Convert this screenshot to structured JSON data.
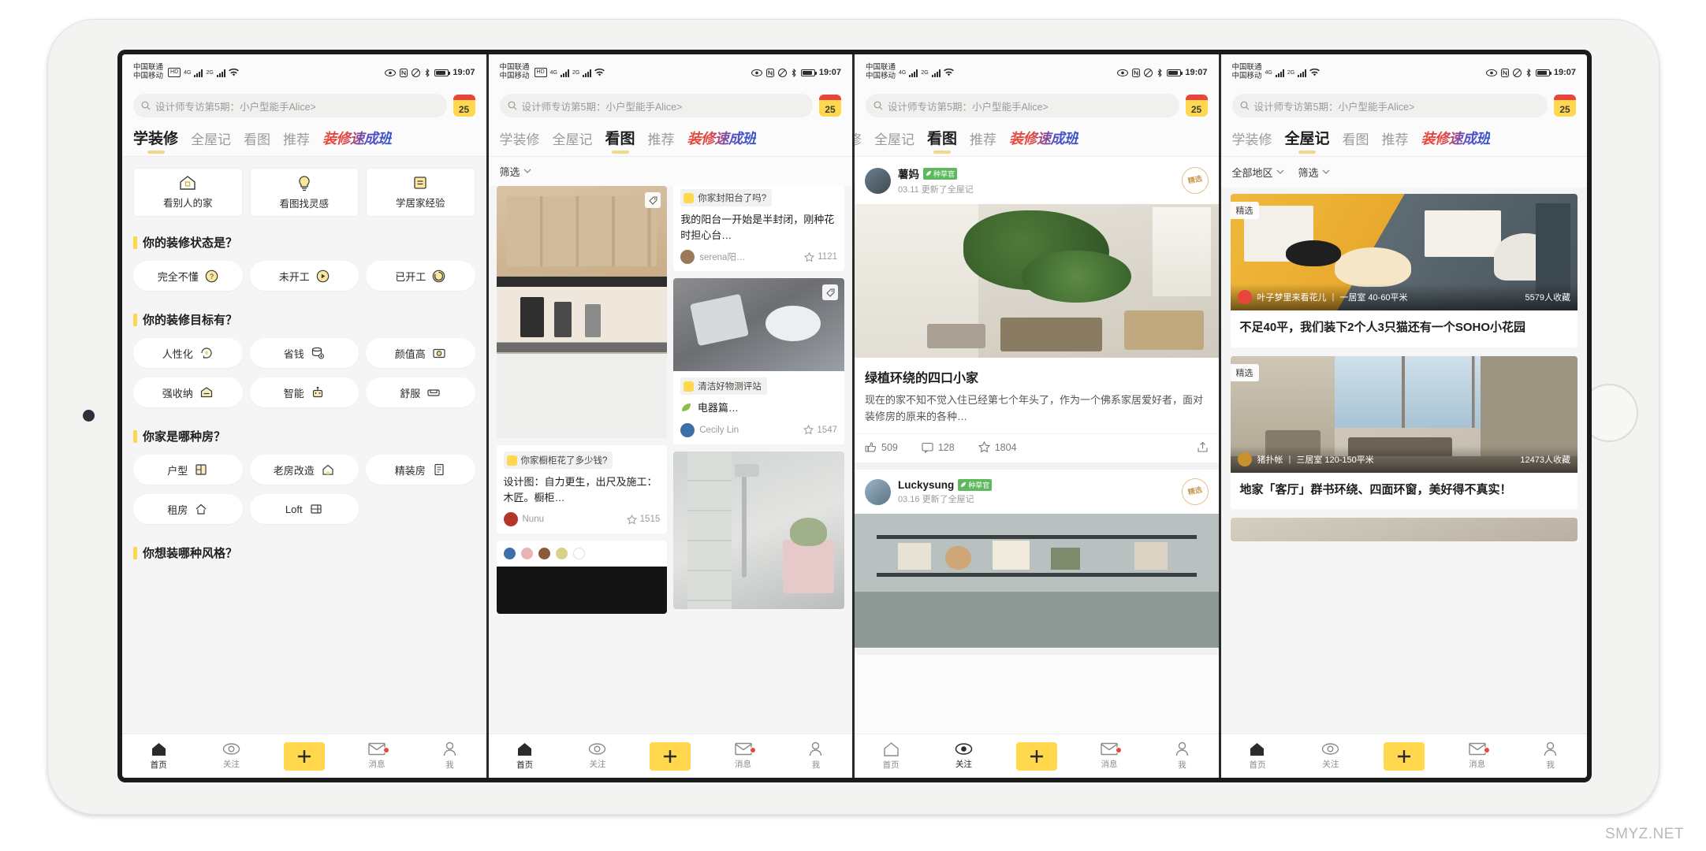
{
  "watermark": "SMYZ.NET",
  "status_bar": {
    "carrier1": "中国联通",
    "carrier2": "中国移动",
    "hd": "HD",
    "net1": "4G",
    "net2": "2G",
    "time": "19:07"
  },
  "search": {
    "placeholder": "设计师专访第5期：小户型能手Alice>",
    "calendar_day": "25"
  },
  "tabs": [
    {
      "label": "学装修"
    },
    {
      "label": "全屋记"
    },
    {
      "label": "看图"
    },
    {
      "label": "推荐"
    },
    {
      "label": "装修速成班"
    }
  ],
  "bottom_nav": [
    {
      "label": "首页",
      "icon": "home-icon"
    },
    {
      "label": "关注",
      "icon": "eye-icon"
    },
    {
      "label": "",
      "icon": "plus-icon"
    },
    {
      "label": "消息",
      "icon": "envelope-icon"
    },
    {
      "label": "我",
      "icon": "person-icon"
    }
  ],
  "panel1": {
    "active_tab": "学装修",
    "quick_cards": [
      {
        "label": "看别人的家",
        "icon": "house-icon"
      },
      {
        "label": "看图找灵感",
        "icon": "lightbulb-icon"
      },
      {
        "label": "学居家经验",
        "icon": "book-icon"
      }
    ],
    "sections": [
      {
        "title": "你的装修状态是？",
        "chips": [
          {
            "label": "完全不懂",
            "icon": "question-circle-icon"
          },
          {
            "label": "未开工",
            "icon": "play-circle-icon"
          },
          {
            "label": "已开工",
            "icon": "progress-circle-icon"
          }
        ]
      },
      {
        "title": "你的装修目标有？",
        "chips": [
          {
            "label": "人性化",
            "icon": "head-idea-icon"
          },
          {
            "label": "省钱",
            "icon": "coins-icon"
          },
          {
            "label": "颜值高",
            "icon": "camera-icon"
          },
          {
            "label": "强收纳",
            "icon": "box-icon"
          },
          {
            "label": "智能",
            "icon": "robot-icon"
          },
          {
            "label": "舒服",
            "icon": "sofa-icon"
          }
        ]
      },
      {
        "title": "你家是哪种房？",
        "chips": [
          {
            "label": "户型",
            "icon": "floorplan-icon"
          },
          {
            "label": "老房改造",
            "icon": "oldhouse-icon"
          },
          {
            "label": "精装房",
            "icon": "document-icon"
          },
          {
            "label": "租房",
            "icon": "rent-icon"
          },
          {
            "label": "Loft",
            "icon": "loft-icon"
          }
        ]
      },
      {
        "title": "你想装哪种风格？",
        "chips": []
      }
    ]
  },
  "panel2": {
    "active_tab": "看图",
    "filter": "筛选",
    "cards_left": [
      {
        "type": "image",
        "image": "kitchen-cabinet-photo",
        "has_price_tag": true
      },
      {
        "type": "text",
        "tag": "你家橱柜花了多少钱?",
        "text": "设计图：自力更生，出尺及施工：木匠。橱柜…",
        "author": "Nunu",
        "favs": "1515",
        "avatar_color": "#b3352c"
      },
      {
        "type": "swatches",
        "colors": [
          "#3d6fa8",
          "#e8b5b5",
          "#8a5a3b",
          "#d9d08a",
          "#ffffff"
        ]
      }
    ],
    "cards_right": [
      {
        "type": "text",
        "tag": "你家封阳台了吗?",
        "text": "我的阳台一开始是半封闭，刚种花时担心台…",
        "author": "serena阳…",
        "favs": "1121",
        "avatar_color": "#9b7a5a"
      },
      {
        "type": "image_text",
        "image": "cleaning-device-photo",
        "tag": "清洁好物测评站",
        "text": "电器篇…",
        "author": "Cecily Lin",
        "favs": "1547",
        "avatar_color": "#3d6fa8",
        "has_price_tag": true
      },
      {
        "type": "image",
        "image": "bathroom-shower-photo"
      }
    ]
  },
  "panel3": {
    "active_tab": "看图",
    "posts": [
      {
        "author": "薯妈",
        "badge": "种草官",
        "meta": "03.11  更新了全屋记",
        "seal": "精选",
        "image": "balcony-plants-photo",
        "title": "绿植环绕的四口小家",
        "desc": "现在的家不知不觉入住已经第七个年头了，作为一个佛系家居爱好者，面对装修房的原来的各种…",
        "likes": "509",
        "comments": "128",
        "favs": "1804"
      },
      {
        "author": "Luckysung",
        "badge": "种草官",
        "meta": "03.16  更新了全屋记",
        "seal": "精选",
        "image": "living-room-shelf-photo",
        "title": "",
        "desc": "",
        "likes": "",
        "comments": "",
        "favs": ""
      }
    ]
  },
  "panel4": {
    "active_tab": "全屋记",
    "filters": [
      {
        "label": "全部地区"
      },
      {
        "label": "筛选"
      }
    ],
    "cards": [
      {
        "badge": "精选",
        "image": "illustration-couple-photo",
        "overlay_author": "叶子梦里来看花儿",
        "overlay_info": "一居室  40-60平米",
        "overlay_right": "5579人收藏",
        "title": "不足40平，我们装下2个人3只猫还有一个SOHO小花园",
        "avatar_color": "#e8453c"
      },
      {
        "badge": "精选",
        "image": "modern-livingroom-photo",
        "overlay_author": "猪扑帐",
        "overlay_info": "三居室  120-150平米",
        "overlay_right": "12473人收藏",
        "title": "地家「客厅」群书环绕、四面环窗，美好得不真实！",
        "avatar_color": "#c9902e"
      }
    ]
  }
}
